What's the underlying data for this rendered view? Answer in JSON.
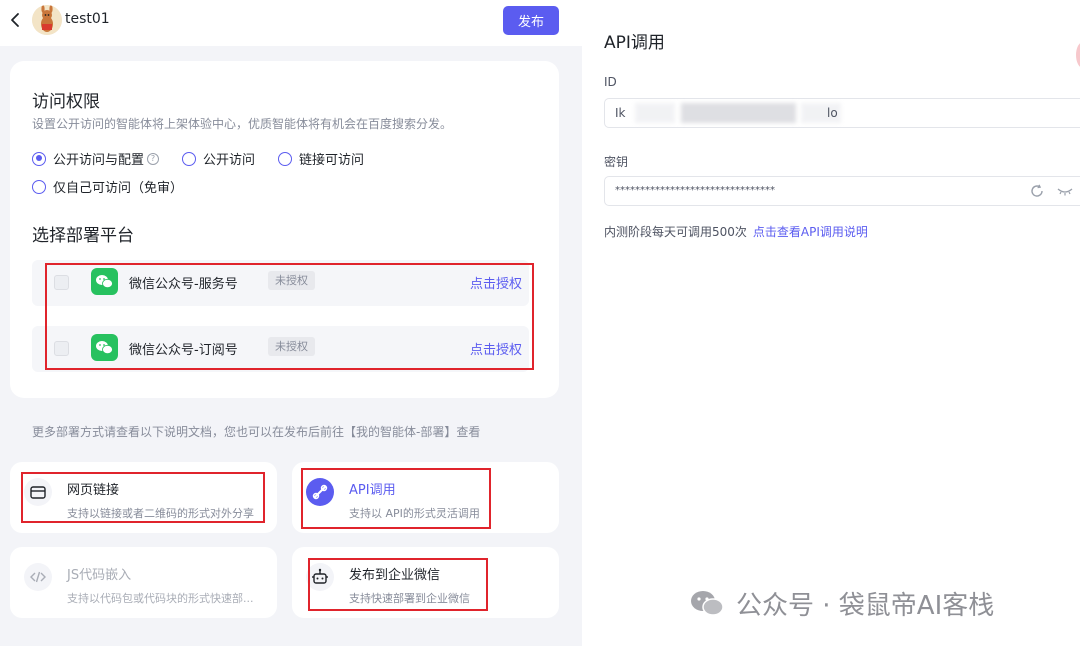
{
  "header": {
    "agent_name": "test01",
    "publish_label": "发布"
  },
  "access": {
    "title": "访问权限",
    "description": "设置公开访问的智能体将上架体验中心，优质智能体将有机会在百度搜索分发。",
    "options": [
      {
        "label": "公开访问与配置",
        "checked": true
      },
      {
        "label": "公开访问",
        "checked": false
      },
      {
        "label": "链接可访问",
        "checked": false
      },
      {
        "label": "仅自己可访问（免审）",
        "checked": false
      }
    ],
    "help_glyph": "?"
  },
  "deploy": {
    "title": "选择部署平台",
    "platforms": [
      {
        "name": "微信公众号-服务号",
        "status": "未授权",
        "action": "点击授权"
      },
      {
        "name": "微信公众号-订阅号",
        "status": "未授权",
        "action": "点击授权"
      }
    ]
  },
  "more_info": "更多部署方式请查看以下说明文档，您也可以在发布后前往【我的智能体-部署】查看",
  "options": [
    {
      "title": "网页链接",
      "desc": "支持以链接或者二维码的形式对外分享",
      "icon": "browser-window-icon"
    },
    {
      "title": "API调用",
      "desc": "支持以 API的形式灵活调用",
      "icon": "api-link-icon"
    },
    {
      "title": "JS代码嵌入",
      "desc": "支持以代码包或代码块的形式快速部...",
      "icon": "code-icon"
    },
    {
      "title": "发布到企业微信",
      "desc": "支持快速部署到企业微信",
      "icon": "robot-icon"
    }
  ],
  "api_panel": {
    "title": "API调用",
    "id_label": "ID",
    "id_prefix": "Ik",
    "id_suffix": "lo",
    "key_label": "密钥",
    "key_value": "********************************",
    "quota_text": "内测阶段每天可调用500次",
    "quota_link": "点击查看API调用说明"
  },
  "watermark": "公众号 · 袋鼠帝AI客栈",
  "colors": {
    "accent": "#5b5cf0",
    "wechat_green": "#27c15f",
    "highlight_red": "#e0242c",
    "background": "#f3f4f8"
  }
}
